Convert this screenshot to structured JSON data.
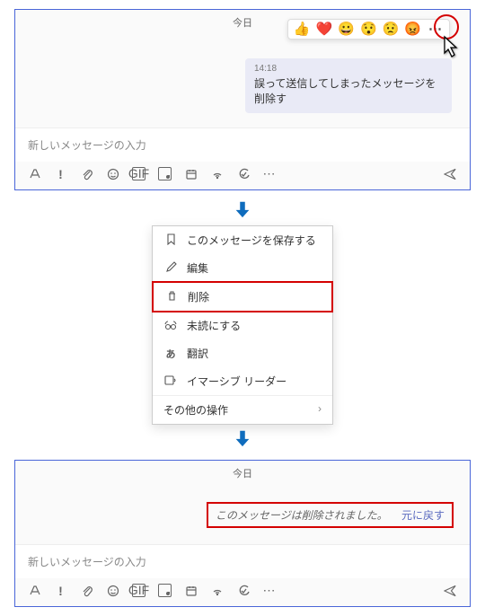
{
  "panel1": {
    "date": "今日",
    "reactions": [
      "👍",
      "❤️",
      "😀",
      "😯",
      "😟",
      "😡"
    ],
    "more": "⋯",
    "message": {
      "time": "14:18",
      "text": "誤って送信してしまったメッセージを削除す"
    },
    "input_placeholder": "新しいメッセージの入力"
  },
  "context_menu": {
    "items": [
      {
        "icon": "bookmark",
        "label": "このメッセージを保存する"
      },
      {
        "icon": "pencil",
        "label": "編集"
      },
      {
        "icon": "trash",
        "label": "削除",
        "highlight": true
      },
      {
        "icon": "unread",
        "label": "未読にする"
      },
      {
        "icon": "translate",
        "label": "翻訳"
      },
      {
        "icon": "reader",
        "label": "イマーシブ リーダー"
      }
    ],
    "more_actions": "その他の操作",
    "chevron": "›"
  },
  "panel2": {
    "date": "今日",
    "deleted_text": "このメッセージは削除されました。",
    "undo": "元に戻す",
    "input_placeholder": "新しいメッセージの入力"
  },
  "toolbar": {
    "format": "Aᵩ",
    "priority": "!",
    "attach": "📎",
    "emoji": "☺",
    "gif": "GIF",
    "sticker": "▢",
    "meet": "📅",
    "stream": "⦿",
    "approvals": "✓",
    "more": "⋯",
    "send": "➤"
  }
}
